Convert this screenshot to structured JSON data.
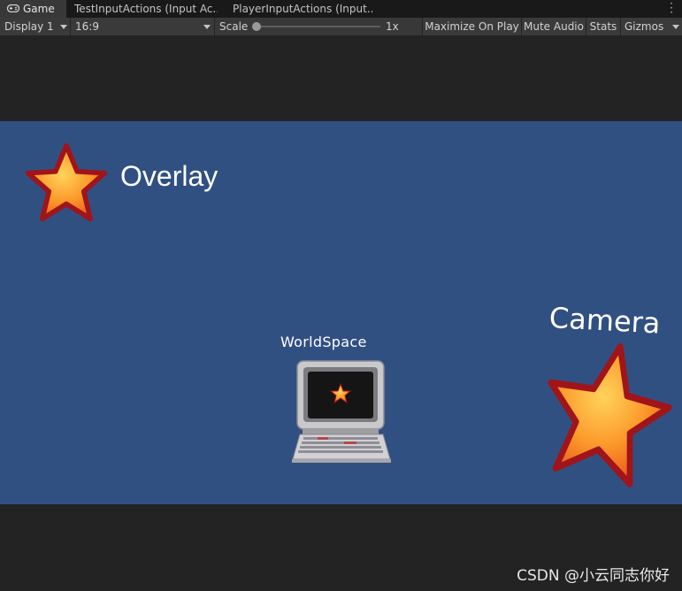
{
  "tabs": [
    {
      "label": "Game",
      "active": true,
      "icon": "gamepad-icon"
    },
    {
      "label": "TestInputActions (Input Ac...",
      "active": false
    },
    {
      "label": "PlayerInputActions (Input...",
      "active": false
    }
  ],
  "toolbar": {
    "display": "Display 1",
    "aspect": "16:9",
    "scale_label": "Scale",
    "scale_value": "1x",
    "maximize_on_play": "Maximize On Play",
    "mute_audio": "Mute Audio",
    "stats": "Stats",
    "gizmos": "Gizmos"
  },
  "scene": {
    "background_color": "#315082",
    "overlay_label": "Overlay",
    "worldspace_label": "WorldSpace",
    "camera_label": "Camera",
    "icons": [
      "star-icon",
      "computer-terminal-icon"
    ]
  },
  "watermark": "CSDN @小云同志你好"
}
